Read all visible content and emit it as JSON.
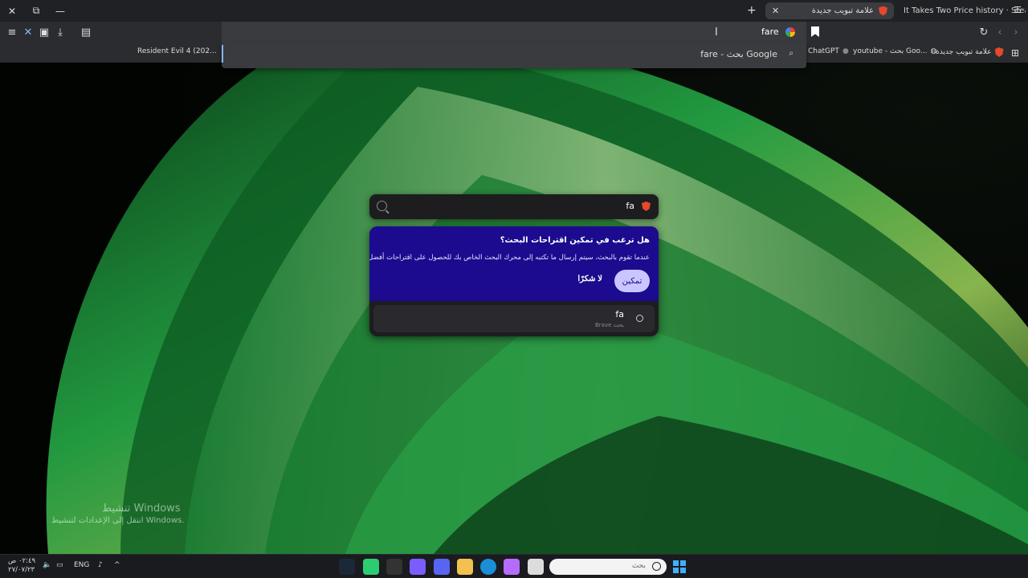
{
  "browser": {
    "tabs": [
      {
        "label": "علامة تبويب جديدة",
        "active": true,
        "icon": "brave-icon"
      },
      {
        "label": "It Takes Two Price history · SteamDB",
        "active": false
      }
    ],
    "new_tab_symbol": "+",
    "window_controls": {
      "close": "✕",
      "restore": "⧉",
      "minimize": "—"
    },
    "omnibox_value": "fare",
    "dropdown_suggestion": "fare - بحث Google",
    "bookmarks": [
      {
        "label": "علامة تبويب جديدة",
        "icon": "brave-icon"
      },
      {
        "label": "youtube - بحث Goo...",
        "icon": "globe-icon"
      },
      {
        "label": "ChatGPT",
        "icon": "chatgpt-icon"
      },
      {
        "label": "Resident Evil 4 (202...",
        "icon": "page-icon"
      }
    ]
  },
  "newtab": {
    "search_value": "fa",
    "prompt_title": "هل ترغب في تمكين اقتراحات البحث؟",
    "prompt_desc": "عندما تقوم بالبحث، سيتم إرسال ما تكتبه إلى محرك البحث الخاص بك للحصول على اقتراحات أفضل.",
    "enable_label": "تمكين",
    "decline_label": "لا شكرًا",
    "suggestion_query": "fa",
    "suggestion_source": "بحث Brave"
  },
  "watermark": {
    "title": "تنشيط Windows",
    "subtitle": "انتقل إلى الإعدادات لتنشيط Windows."
  },
  "taskbar": {
    "search_placeholder": "بحث",
    "language": "ENG",
    "time": "٠٢:٤٩ ص",
    "date": "٢٧/٠٧/٢٣"
  },
  "colors": {
    "prompt_bg": "#1c0b8f",
    "enable_bg": "#c9c6ff",
    "accent": "#8ab4f8"
  }
}
